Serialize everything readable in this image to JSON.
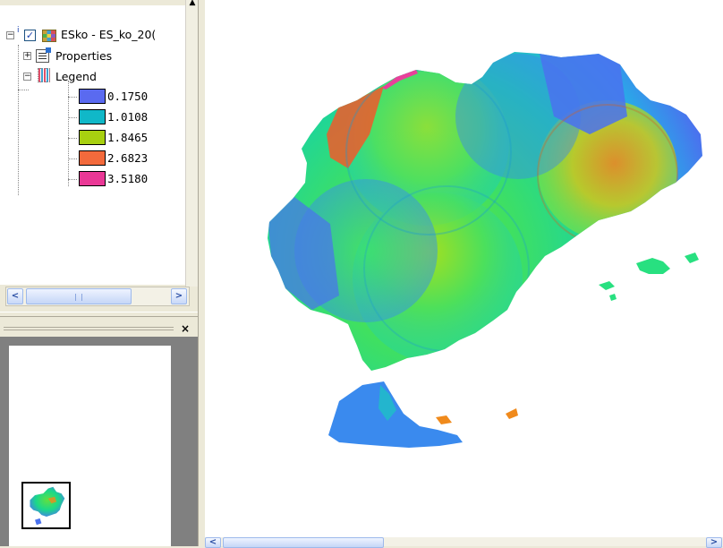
{
  "toc": {
    "layer_name": "ESko - ES_ko_20(",
    "properties_label": "Properties",
    "legend_label": "Legend",
    "legend_items": [
      {
        "label": "0.1750",
        "color": "#5a6af0"
      },
      {
        "label": "1.0108",
        "color": "#10b8c8"
      },
      {
        "label": "1.8465",
        "color": "#a8d010"
      },
      {
        "label": "2.6823",
        "color": "#f36a3c"
      },
      {
        "label": "3.5180",
        "color": "#ea3896"
      }
    ]
  },
  "overview": {
    "close_glyph": "×"
  },
  "map": {
    "palette": [
      "#4a72ee",
      "#15c2e0",
      "#28e07a",
      "#a8e020",
      "#f08a1c",
      "#f25a2e",
      "#e8409a"
    ]
  },
  "icons": [
    "checkbox-icon",
    "layer-raster-icon",
    "properties-icon",
    "legend-icon",
    "expand-icon",
    "collapse-icon",
    "close-icon",
    "scroll-left-icon",
    "scroll-right-icon",
    "scroll-up-icon"
  ]
}
